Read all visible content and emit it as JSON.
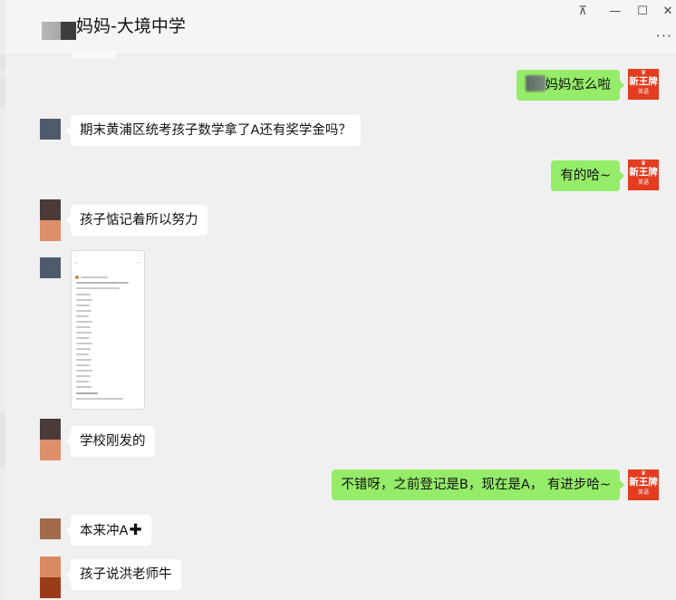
{
  "window": {
    "title": "妈妈-大境中学",
    "controls": {
      "pin": "⊼",
      "minimize": "—",
      "maximize": "☐",
      "close": "✕"
    },
    "more": "···"
  },
  "messages": [
    {
      "side": "out",
      "text": "妈妈怎么啦",
      "has_blur_name": true
    },
    {
      "side": "in",
      "text": "期末黄浦区统考孩子数学拿了A还有奖学金吗？"
    },
    {
      "side": "out",
      "text": "有的哈~"
    },
    {
      "side": "in",
      "text": "孩子惦记着所以努力"
    },
    {
      "side": "in",
      "type": "image"
    },
    {
      "side": "in",
      "text": "学校刚发的"
    },
    {
      "side": "out",
      "text": "不错呀，之前登记是B，现在是A， 有进步哈~"
    },
    {
      "side": "in",
      "text": "本来冲A"
    },
    {
      "side": "in",
      "text": "孩子说洪老师牛"
    }
  ],
  "self_avatar": {
    "brand": "新王牌",
    "sub": "英语",
    "color": "#e33c1f"
  },
  "colors": {
    "out_bubble": "#95ec69",
    "in_bubble": "#ffffff",
    "background": "#f0f0f0"
  }
}
